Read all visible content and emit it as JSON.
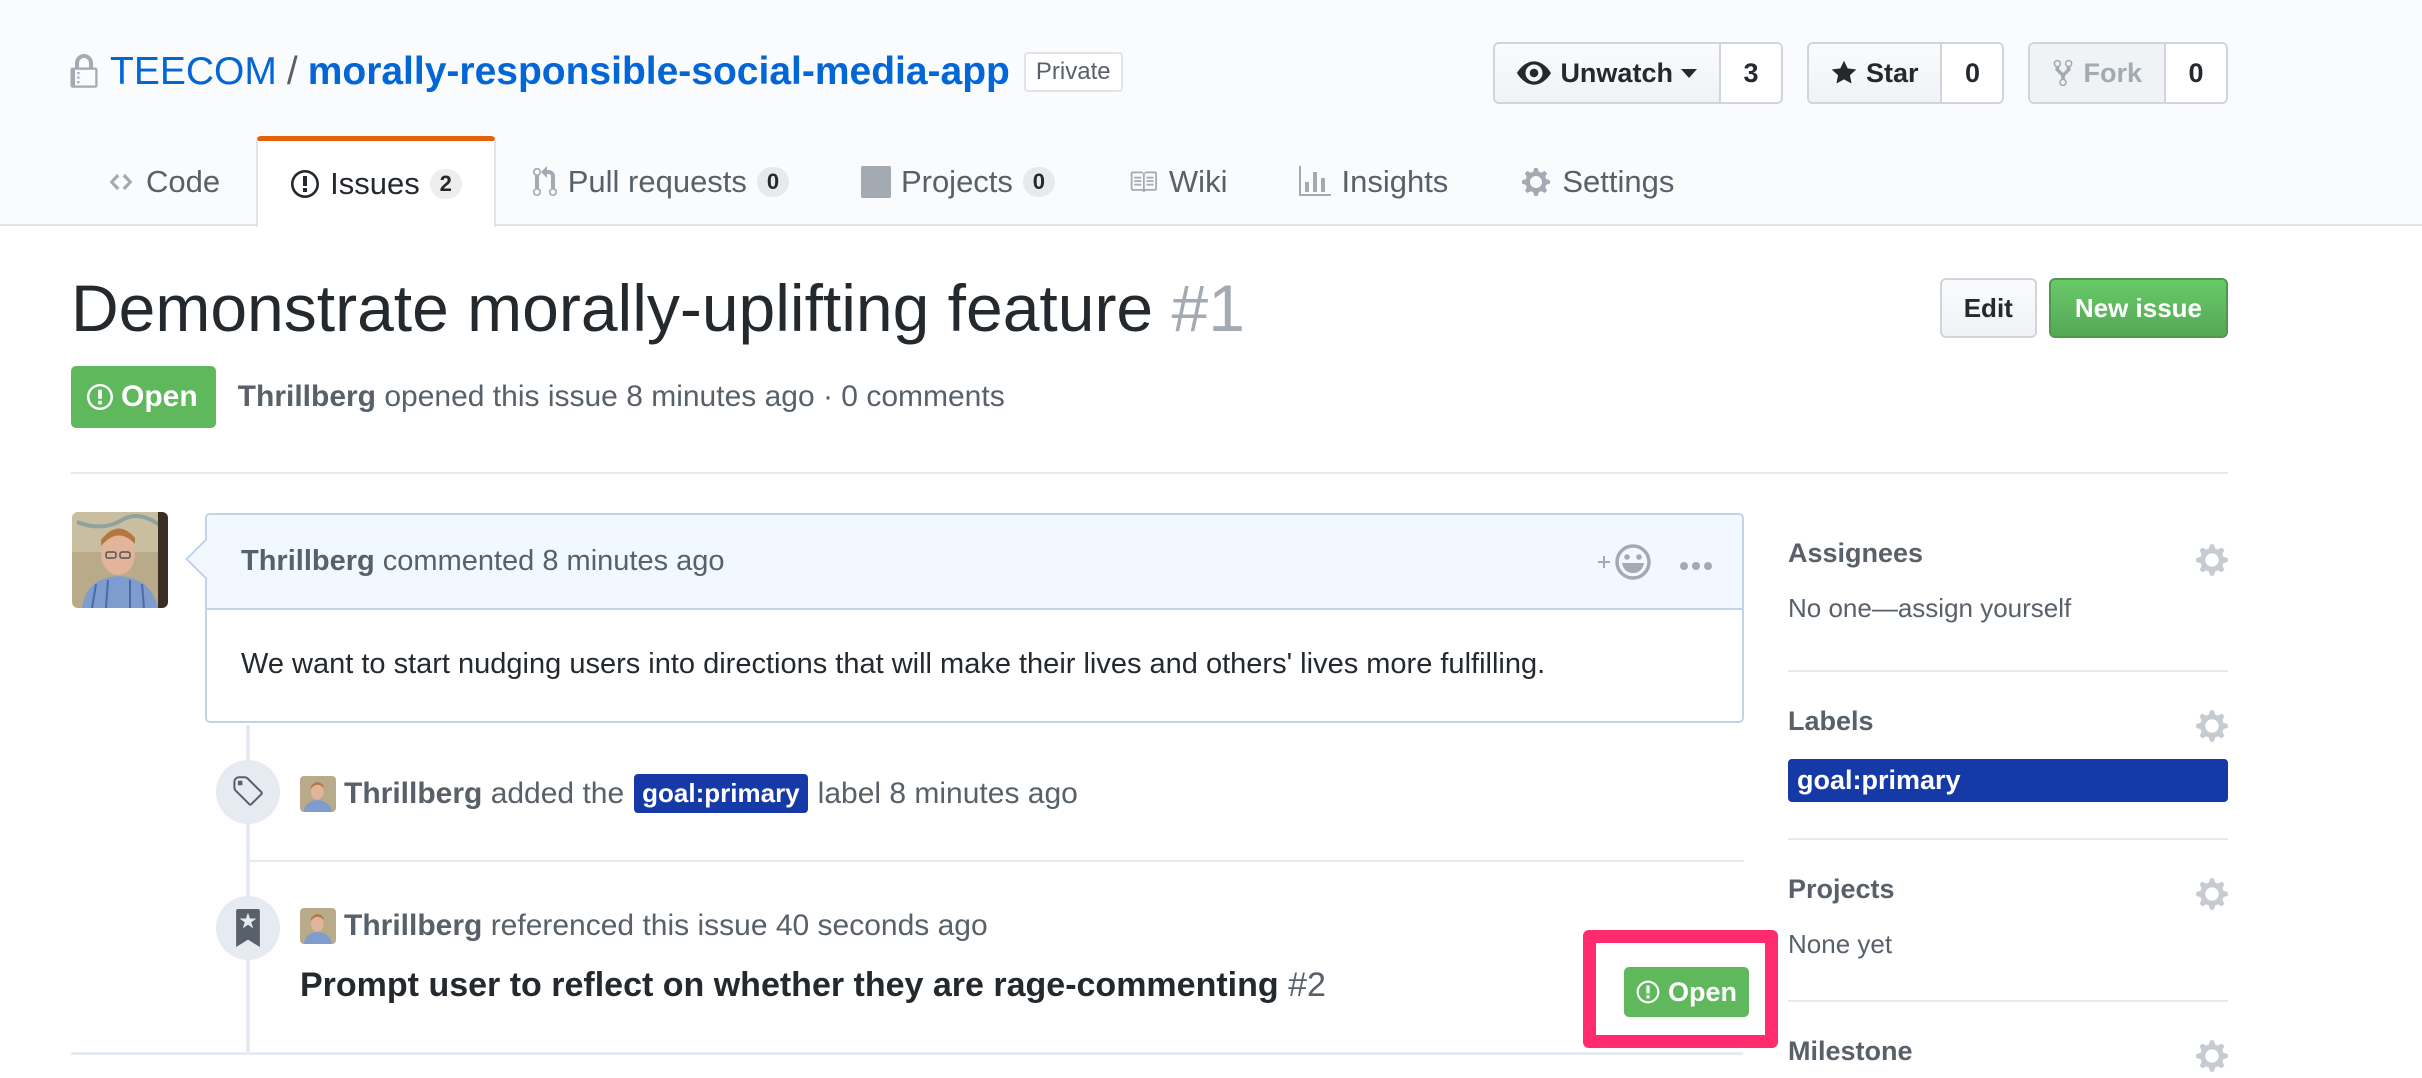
{
  "repo": {
    "owner": "TEECOM",
    "separator": "/",
    "name": "morally-responsible-social-media-app",
    "visibility": "Private",
    "lock_icon": "lock-icon"
  },
  "actions": {
    "watch": {
      "label": "Unwatch",
      "count": "3",
      "icon": "eye-icon"
    },
    "star": {
      "label": "Star",
      "count": "0",
      "icon": "star-icon"
    },
    "fork": {
      "label": "Fork",
      "count": "0",
      "icon": "repo-forked-icon"
    }
  },
  "nav": [
    {
      "label": "Code",
      "icon": "code-icon",
      "selected": false
    },
    {
      "label": "Issues",
      "counter": "2",
      "icon": "issue-opened-icon",
      "selected": true
    },
    {
      "label": "Pull requests",
      "counter": "0",
      "icon": "git-pull-request-icon",
      "selected": false
    },
    {
      "label": "Projects",
      "counter": "0",
      "icon": "project-icon",
      "selected": false
    },
    {
      "label": "Wiki",
      "icon": "book-icon",
      "selected": false
    },
    {
      "label": "Insights",
      "icon": "graph-icon",
      "selected": false
    },
    {
      "label": "Settings",
      "icon": "gear-icon",
      "selected": false
    }
  ],
  "issue": {
    "title": "Demonstrate morally-uplifting feature",
    "number": "#1",
    "state": "Open",
    "author": "Thrillberg",
    "meta_text": "opened this issue 8 minutes ago · 0 comments",
    "edit_label": "Edit",
    "new_issue_label": "New issue"
  },
  "comment": {
    "author": "Thrillberg",
    "action_text": "commented 8 minutes ago",
    "body": "We want to start nudging users into directions that will make their lives and others' lives more fulfilling.",
    "reaction_icon": "smiley-icon",
    "more_icon": "kebab-horizontal-icon"
  },
  "timeline": [
    {
      "type": "labeled",
      "icon": "tag-icon",
      "actor": "Thrillberg",
      "pre_text": "added the",
      "label": "goal:primary",
      "post_text": "label 8 minutes ago"
    },
    {
      "type": "cross-referenced",
      "icon": "bookmark-icon",
      "actor": "Thrillberg",
      "text": "referenced this issue 40 seconds ago",
      "ref_title": "Prompt user to reflect on whether they are rage-commenting",
      "ref_number": "#2",
      "ref_state": "Open"
    }
  ],
  "sidebar": {
    "assignees": {
      "heading": "Assignees",
      "value": "No one—assign yourself"
    },
    "labels": {
      "heading": "Labels",
      "items": [
        "goal:primary"
      ]
    },
    "projects": {
      "heading": "Projects",
      "value": "None yet"
    },
    "milestone": {
      "heading": "Milestone"
    }
  },
  "colors": {
    "link": "#0366d6",
    "open_state": "#5fb85c",
    "label_goal_primary": "#1639a8",
    "nav_selected_accent": "#e36209",
    "highlight_annotation": "#ff2b6e",
    "new_issue_button": "#5cb85c"
  }
}
